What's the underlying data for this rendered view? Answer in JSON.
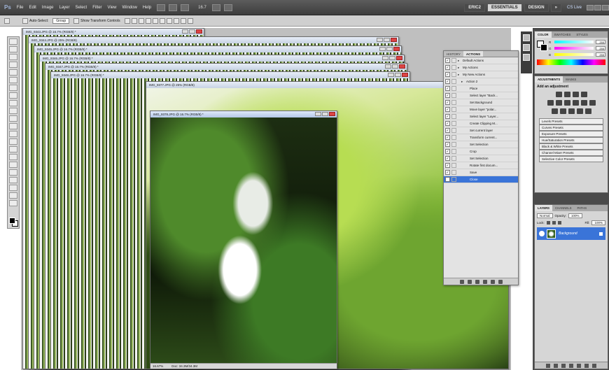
{
  "app": {
    "logo": "Ps"
  },
  "menubar": {
    "items": [
      "File",
      "Edit",
      "Image",
      "Layer",
      "Select",
      "Filter",
      "View",
      "Window",
      "Help"
    ],
    "zoom": "16.7",
    "workspaces": [
      "ERIC2",
      "ESSENTIALS",
      "DESIGN"
    ],
    "more": "»",
    "cs_live": "CS Live"
  },
  "options_bar": {
    "auto_select_label": "Auto-Select:",
    "auto_select_value": "Group",
    "transform_label": "Show Transform Controls"
  },
  "documents": [
    {
      "title": "IMG_9343.JPG @ 16.7% (RGB/8) *"
    },
    {
      "title": "IMG_9344.JPG @ 25% (RGB/8)"
    },
    {
      "title": "IMG_9345.JPG @ 16.7% (RGB/8) *"
    },
    {
      "title": "IMG_9346.JPG @ 16.7% (RGB/8) *"
    },
    {
      "title": "IMG_9347.JPG @ 16.7% (RGB/8) *"
    },
    {
      "title": "IMG_9348.JPG @ 16.7% (RGB/8) *"
    },
    {
      "title": "IMG_9377.JPG @ 25% (RGB/8)"
    },
    {
      "title": "IMG_9378.JPG @ 16.7% (RGB/8) *"
    }
  ],
  "active_status": {
    "zoom": "16.67%",
    "doc": "Doc: 34.3M/34.3M"
  },
  "actions_panel": {
    "tabs": [
      "HISTORY",
      "ACTIONS"
    ],
    "active_tab": "ACTIONS",
    "rows": [
      {
        "label": "Default Actions",
        "level": 0,
        "selected": false
      },
      {
        "label": "My Actions",
        "level": 0,
        "selected": false
      },
      {
        "label": "My New Actions",
        "level": 0,
        "selected": false
      },
      {
        "label": "Action 2",
        "level": 1,
        "selected": false
      },
      {
        "label": "Place",
        "level": 2,
        "selected": false
      },
      {
        "label": "Select layer \"Back...",
        "level": 2,
        "selected": false
      },
      {
        "label": "Set Background",
        "level": 2,
        "selected": false
      },
      {
        "label": "Move layer \"polar...",
        "level": 2,
        "selected": false
      },
      {
        "label": "Select layer \"Layer...",
        "level": 2,
        "selected": false
      },
      {
        "label": "Create Clipping M...",
        "level": 2,
        "selected": false
      },
      {
        "label": "Set current layer",
        "level": 2,
        "selected": false
      },
      {
        "label": "Transform current...",
        "level": 2,
        "selected": false
      },
      {
        "label": "Set Selection",
        "level": 2,
        "selected": false
      },
      {
        "label": "Crop",
        "level": 2,
        "selected": false
      },
      {
        "label": "Set Selection",
        "level": 2,
        "selected": false
      },
      {
        "label": "Rotate first docum...",
        "level": 2,
        "selected": false
      },
      {
        "label": "Save",
        "level": 2,
        "selected": false
      },
      {
        "label": "Close",
        "level": 2,
        "selected": true
      }
    ]
  },
  "color_panel": {
    "tabs": [
      "COLOR",
      "SWATCHES",
      "STYLES"
    ],
    "channels": [
      {
        "name": "R",
        "value": "255",
        "gradient": "linear-gradient(90deg,#00ffff,#ffffff)"
      },
      {
        "name": "G",
        "value": "255",
        "gradient": "linear-gradient(90deg,#ff00ff,#ffffff)"
      },
      {
        "name": "B",
        "value": "255",
        "gradient": "linear-gradient(90deg,#ffff00,#ffffff)"
      }
    ]
  },
  "adjustments_panel": {
    "tabs": [
      "ADJUSTMENTS",
      "MASKS"
    ],
    "title": "Add an adjustment",
    "presets": [
      "Levels Presets",
      "Curves Presets",
      "Exposure Presets",
      "Hue/Saturation Presets",
      "Black & White Presets",
      "Channel Mixer Presets",
      "Selective Color Presets"
    ]
  },
  "layers_panel": {
    "tabs": [
      "LAYERS",
      "CHANNELS",
      "PATHS"
    ],
    "blend_mode": "Normal",
    "opacity_label": "Opacity:",
    "opacity": "100%",
    "lock_label": "Lock:",
    "fill_label": "Fill:",
    "fill": "100%",
    "layer_name": "Background"
  },
  "colors": {
    "accent": "#3a74d8",
    "chrome_dark": "#3d3d3d"
  }
}
